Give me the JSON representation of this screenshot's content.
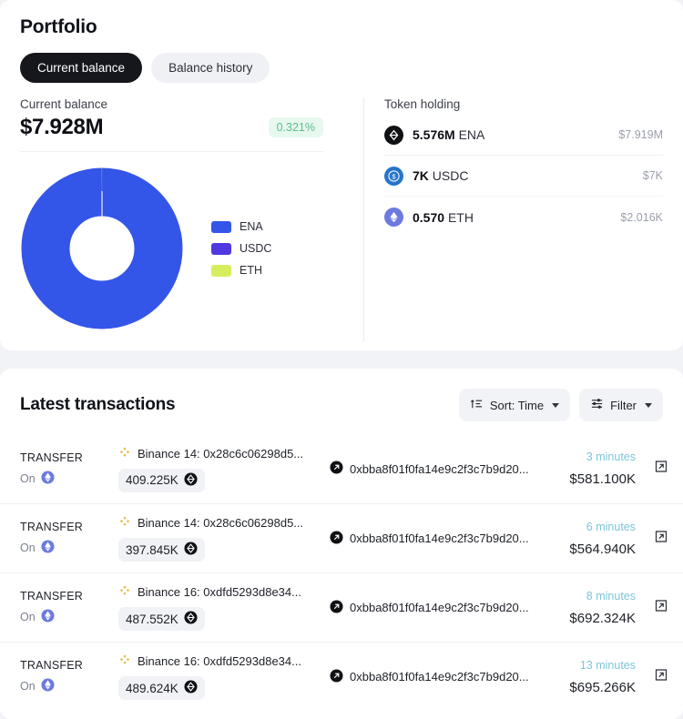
{
  "portfolio": {
    "title": "Portfolio",
    "tabs": [
      {
        "label": "Current balance",
        "active": true
      },
      {
        "label": "Balance history",
        "active": false
      }
    ],
    "balance": {
      "label": "Current balance",
      "amount": "$7.928M",
      "change": "0.321%",
      "change_color": "#5bbd8a"
    },
    "token_holding": {
      "title": "Token holding",
      "rows": [
        {
          "icon": "ena-token-icon",
          "amount": "5.576M",
          "symbol": "ENA",
          "value": "$7.919M"
        },
        {
          "icon": "usdc-token-icon",
          "amount": "7K",
          "symbol": "USDC",
          "value": "$7K"
        },
        {
          "icon": "eth-token-icon",
          "amount": "0.570",
          "symbol": "ETH",
          "value": "$2.016K"
        }
      ]
    }
  },
  "chart_data": {
    "type": "pie",
    "title": "",
    "legend_position": "right",
    "categories": [
      "ENA",
      "USDC",
      "ETH"
    ],
    "values": [
      7.919,
      0.007,
      0.002016
    ],
    "percentages": [
      99.89,
      0.09,
      0.03
    ],
    "colors": [
      "#3355e8",
      "#5038e0",
      "#d6ee5e"
    ],
    "unit": "$M",
    "donut": true
  },
  "transactions": {
    "title": "Latest transactions",
    "sort_button": {
      "label": "Sort: Time",
      "icon": "sort-icon"
    },
    "filter_button": {
      "label": "Filter",
      "icon": "filter-icon"
    },
    "on_label": "On",
    "rows": [
      {
        "type": "TRANSFER",
        "chain_icon": "ethereum-chain-icon",
        "from": "Binance 14: 0x28c6c06298d5...",
        "to": "0xbba8f01f0fa14e9c2f3c7b9d20...",
        "amount": "409.225K",
        "time": "3 minutes",
        "usd": "$581.100K"
      },
      {
        "type": "TRANSFER",
        "chain_icon": "ethereum-chain-icon",
        "from": "Binance 14: 0x28c6c06298d5...",
        "to": "0xbba8f01f0fa14e9c2f3c7b9d20...",
        "amount": "397.845K",
        "time": "6 minutes",
        "usd": "$564.940K"
      },
      {
        "type": "TRANSFER",
        "chain_icon": "ethereum-chain-icon",
        "from": "Binance 16: 0xdfd5293d8e34...",
        "to": "0xbba8f01f0fa14e9c2f3c7b9d20...",
        "amount": "487.552K",
        "time": "8 minutes",
        "usd": "$692.324K"
      },
      {
        "type": "TRANSFER",
        "chain_icon": "ethereum-chain-icon",
        "from": "Binance 16: 0xdfd5293d8e34...",
        "to": "0xbba8f01f0fa14e9c2f3c7b9d20...",
        "amount": "489.624K",
        "time": "13 minutes",
        "usd": "$695.266K"
      }
    ]
  }
}
